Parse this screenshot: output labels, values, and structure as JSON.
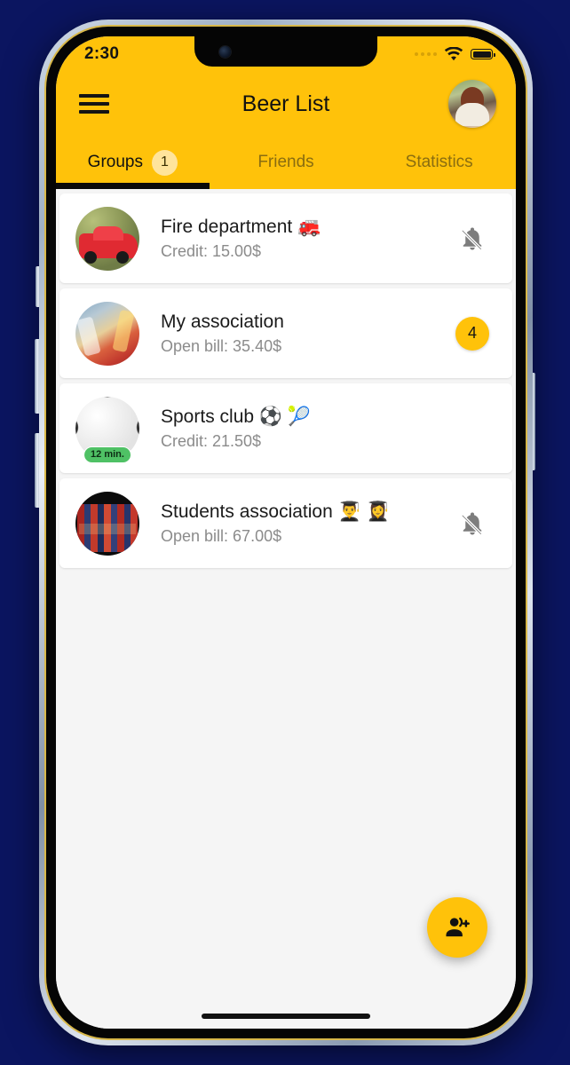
{
  "status_bar": {
    "time": "2:30",
    "signal_icon": "signal-dots-icon",
    "wifi_icon": "wifi-icon",
    "battery_icon": "battery-full-icon"
  },
  "app_bar": {
    "menu_icon": "hamburger-menu-icon",
    "title": "Beer List",
    "avatar_icon": "profile-avatar"
  },
  "tabs": [
    {
      "label": "Groups",
      "badge": "1",
      "active": true
    },
    {
      "label": "Friends",
      "badge": "",
      "active": false
    },
    {
      "label": "Statistics",
      "badge": "",
      "active": false
    }
  ],
  "groups": [
    {
      "name": "Fire department 🚒",
      "subtitle": "Credit: 15.00$",
      "avatar": "fire-truck-avatar",
      "trailing_type": "bell-off-icon",
      "trailing_value": "",
      "time_chip": ""
    },
    {
      "name": "My association",
      "subtitle": "Open bill: 35.40$",
      "avatar": "party-drinks-avatar",
      "trailing_type": "count-badge",
      "trailing_value": "4",
      "time_chip": ""
    },
    {
      "name": "Sports club ⚽ 🎾",
      "subtitle": "Credit: 21.50$",
      "avatar": "soccer-ball-avatar",
      "trailing_type": "none",
      "trailing_value": "",
      "time_chip": "12 min."
    },
    {
      "name": "Students association 👨‍🎓 👩‍🎓",
      "subtitle": "Open bill: 67.00$",
      "avatar": "books-avatar",
      "trailing_type": "bell-off-icon",
      "trailing_value": "",
      "time_chip": ""
    }
  ],
  "fab": {
    "icon": "person-add-icon"
  },
  "colors": {
    "brand_yellow": "#ffc20a",
    "badge_light_yellow": "#ffe49b",
    "chip_green": "#4fc165",
    "screen_bg": "#fafafa",
    "list_bg": "#f5f5f5",
    "page_bg": "#0b1560"
  }
}
